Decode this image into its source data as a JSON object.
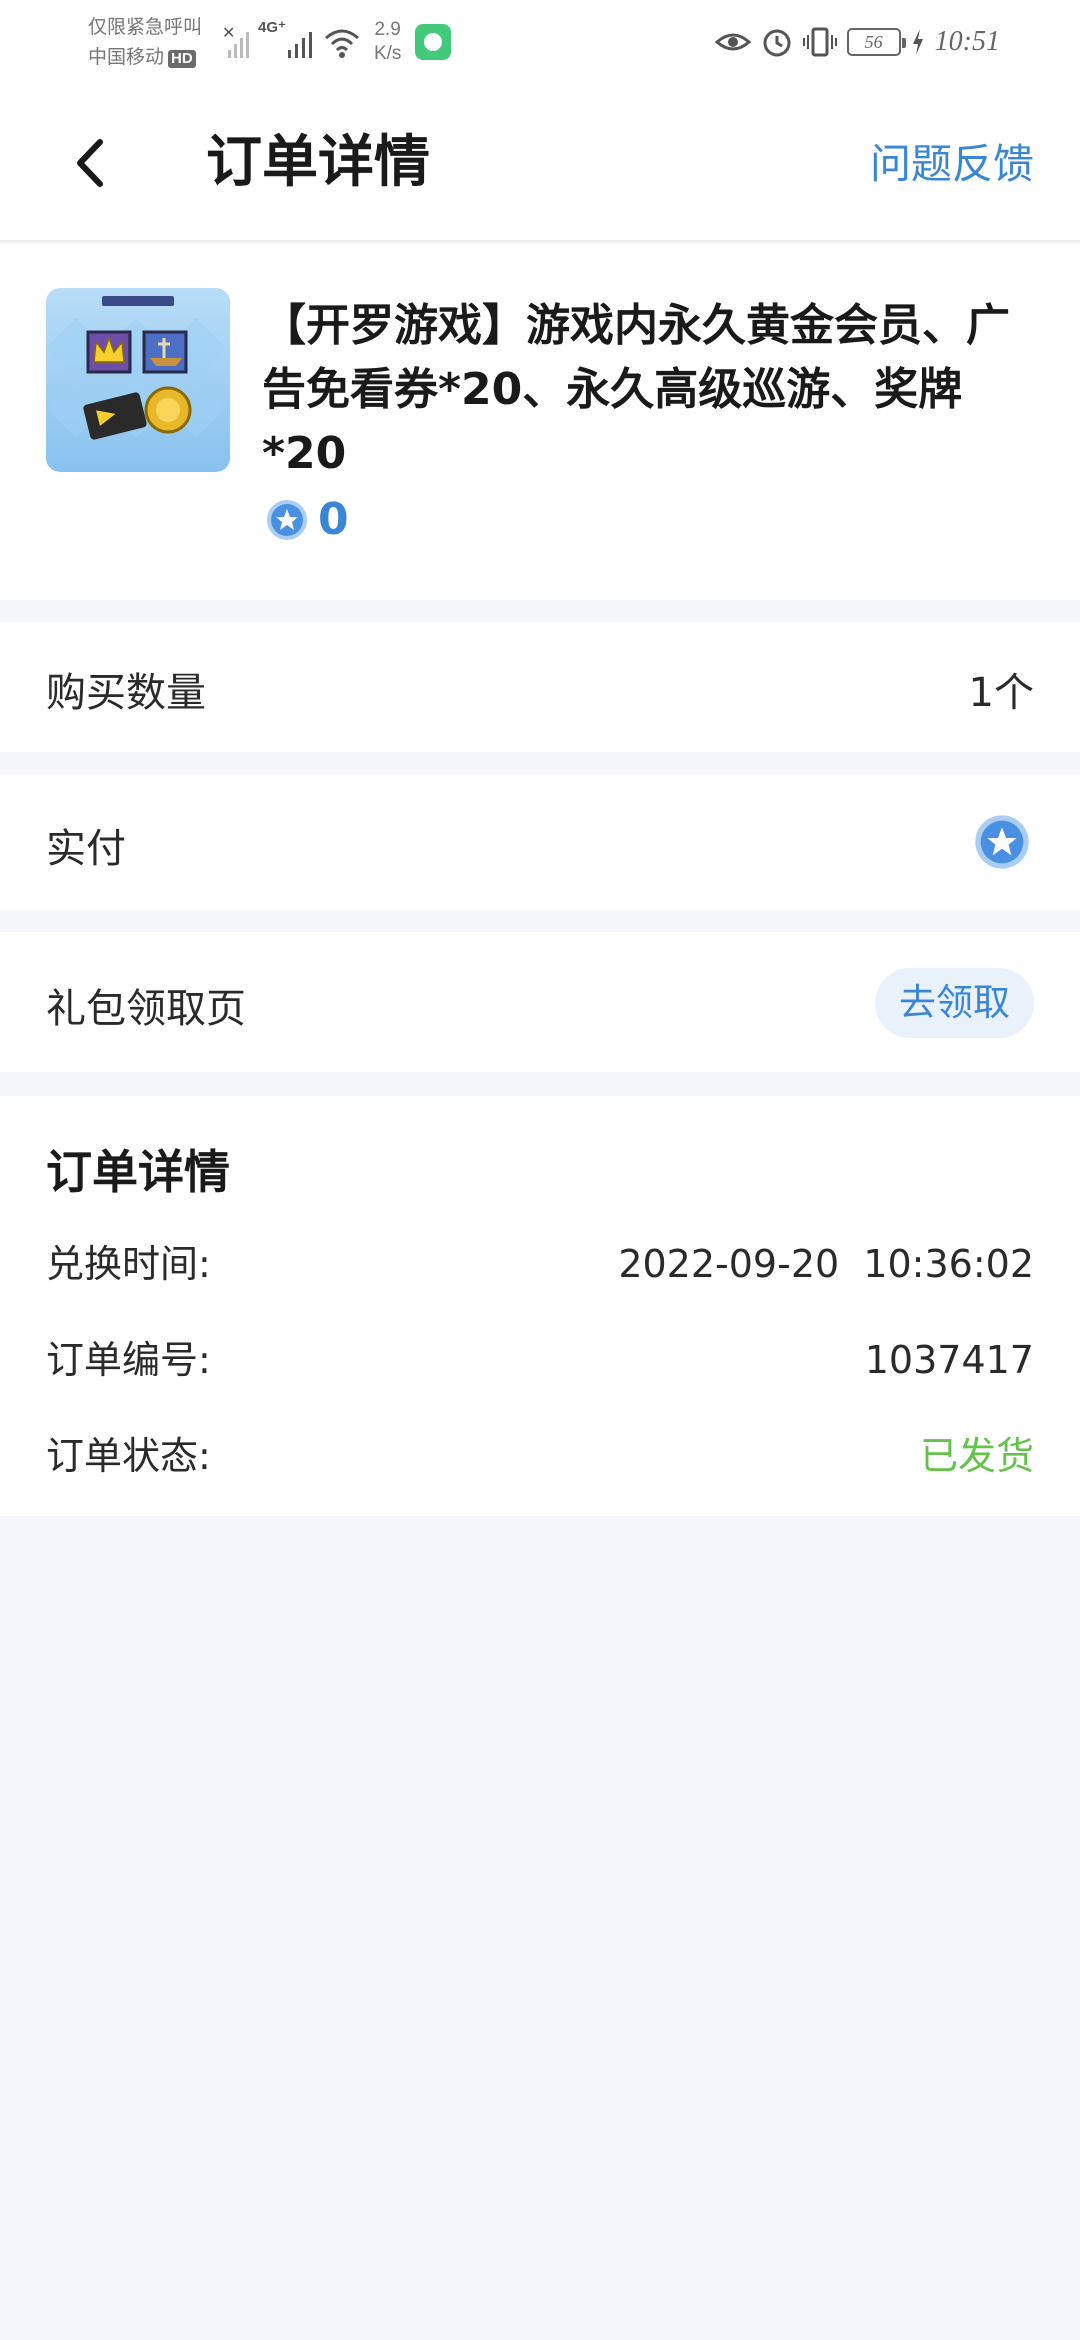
{
  "status_bar": {
    "line1": "仅限紧急呼叫",
    "line2": "中国移动",
    "hd_badge": "HD",
    "network": "4G⁺",
    "speed_value": "2.9",
    "speed_unit": "K/s",
    "battery": "56",
    "time": "10:51"
  },
  "nav": {
    "title": "订单详情",
    "feedback_label": "问题反馈"
  },
  "product": {
    "title": "【开罗游戏】游戏内永久黄金会员、广告免看券*20、永久高级巡游、奖牌*20",
    "price": "0",
    "coin_color": "#4a90e2"
  },
  "rows": {
    "quantity_label": "购买数量",
    "quantity_value": "1个",
    "paid_label": "实付",
    "gift_label": "礼包领取页",
    "claim_label": "去领取"
  },
  "details": {
    "heading": "订单详情",
    "items": [
      {
        "label": "兑换时间:",
        "value": "2022-09-20  10:36:02"
      },
      {
        "label": "订单编号:",
        "value": "1037417"
      },
      {
        "label": "订单状态:",
        "value": "已发货"
      }
    ],
    "status_color": "#63c34a"
  },
  "colors": {
    "accent": "#3a86d6",
    "background": "#f5f7fa"
  }
}
